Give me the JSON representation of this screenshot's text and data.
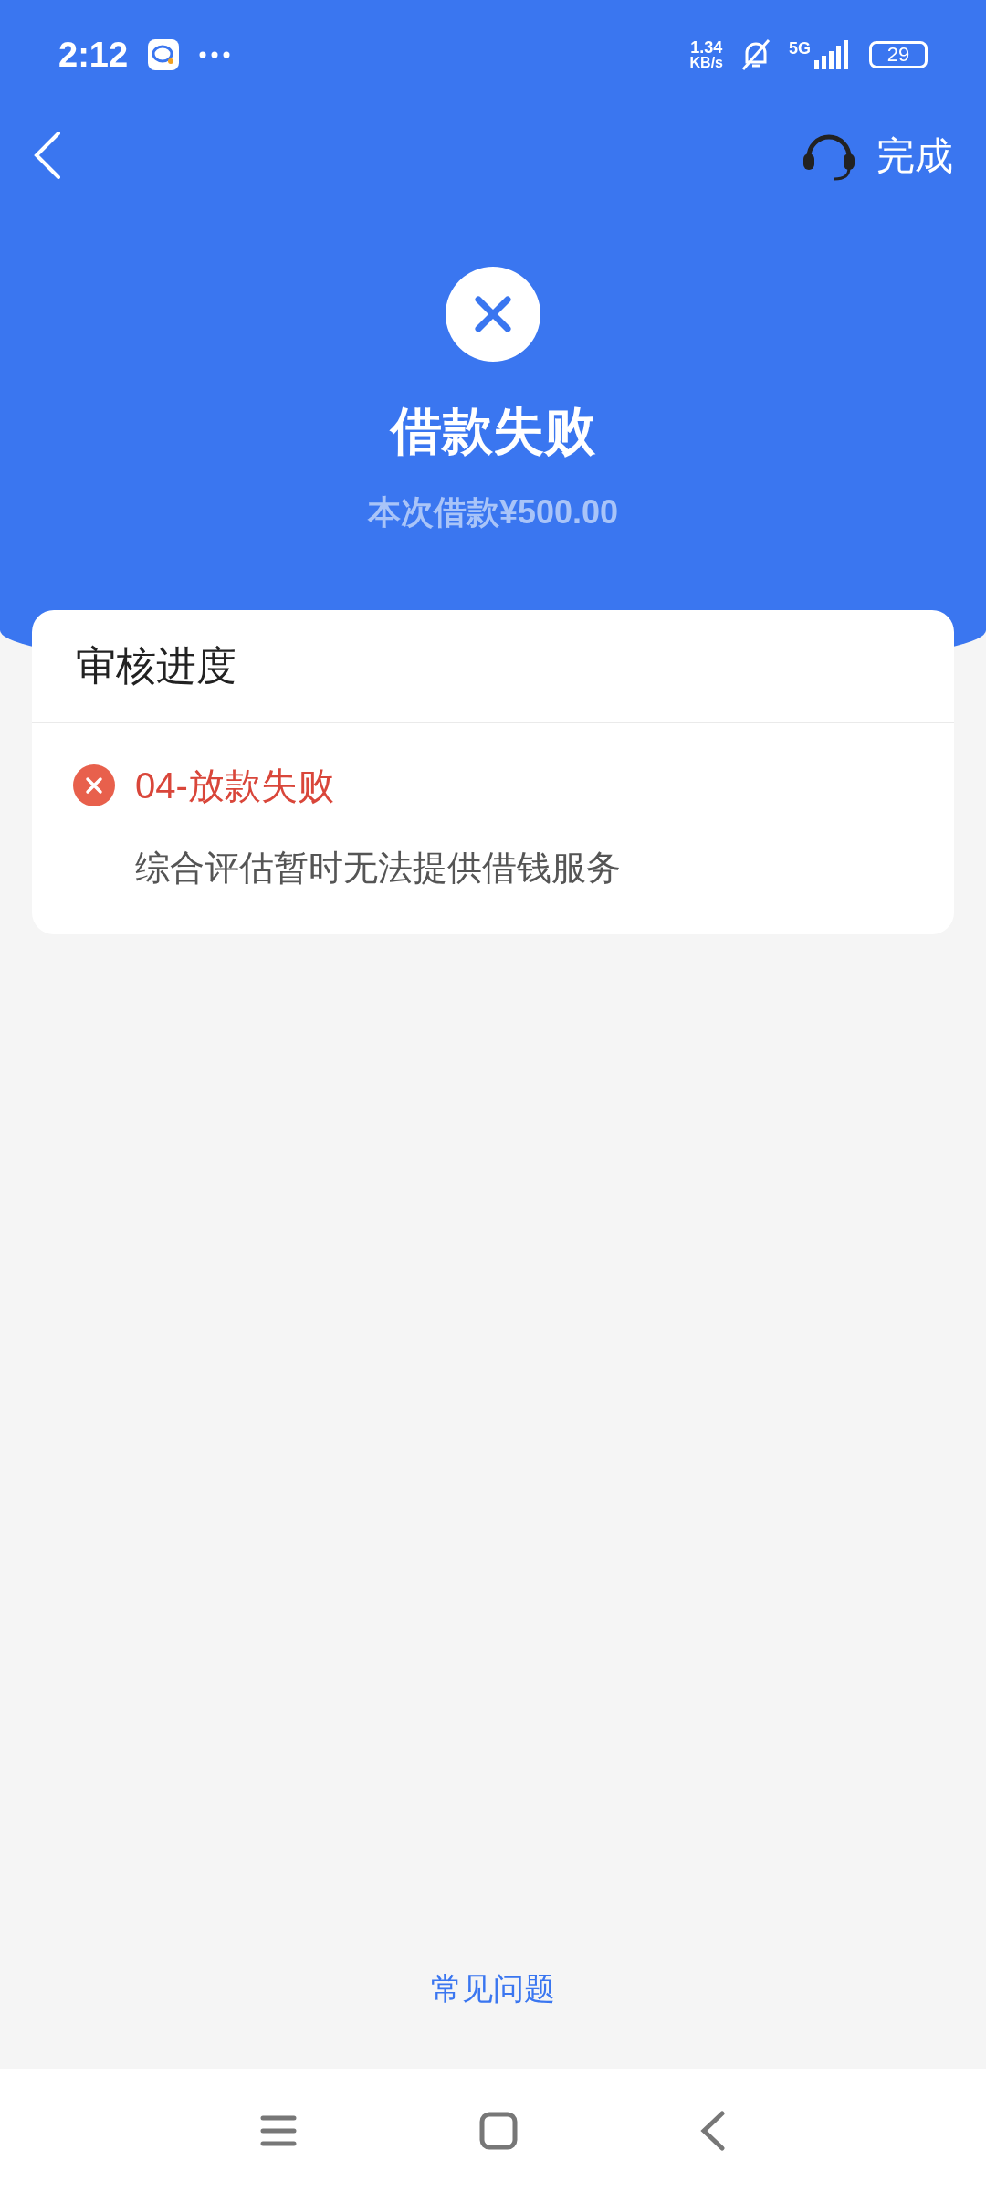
{
  "status_bar": {
    "time": "2:12",
    "speed_value": "1.34",
    "speed_unit": "KB/s",
    "network": "5G",
    "battery": "29"
  },
  "nav": {
    "done": "完成"
  },
  "result": {
    "kind": "failed",
    "title": "借款失败",
    "subtitle": "本次借款¥500.00"
  },
  "progress": {
    "title": "审核进度",
    "steps": [
      {
        "kind": "failed",
        "title": "04-放款失败",
        "detail": "综合评估暂时无法提供借钱服务"
      }
    ]
  },
  "faq_link": "常见问题"
}
